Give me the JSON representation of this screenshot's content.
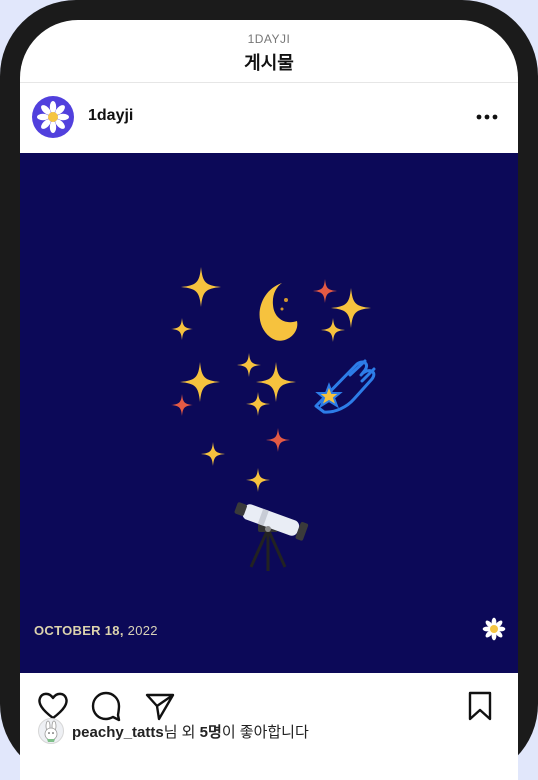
{
  "nav": {
    "account_caption": "1DAYJI",
    "title": "게시물"
  },
  "post": {
    "username": "1dayji",
    "more_icon": "more-horizontal-icon",
    "date_bold": "OCTOBER 18,",
    "date_rest": " 2022"
  },
  "actions": {
    "like_icon": "heart-icon",
    "comment_icon": "comment-icon",
    "share_icon": "send-icon",
    "save_icon": "bookmark-icon"
  },
  "likes": {
    "liker": "peachy_tatts",
    "suffix_1": "님 외 ",
    "count": "5명",
    "suffix_2": "이 좋아합니다"
  },
  "colors": {
    "frame": "#1b1b1b",
    "background": "#e1e7fb",
    "post_bg": "#0c0958",
    "avatar_bg": "#5140dd",
    "star_yellow": "#f6c23e",
    "star_red": "#e45a44",
    "comet_blue": "#2d7de8"
  }
}
